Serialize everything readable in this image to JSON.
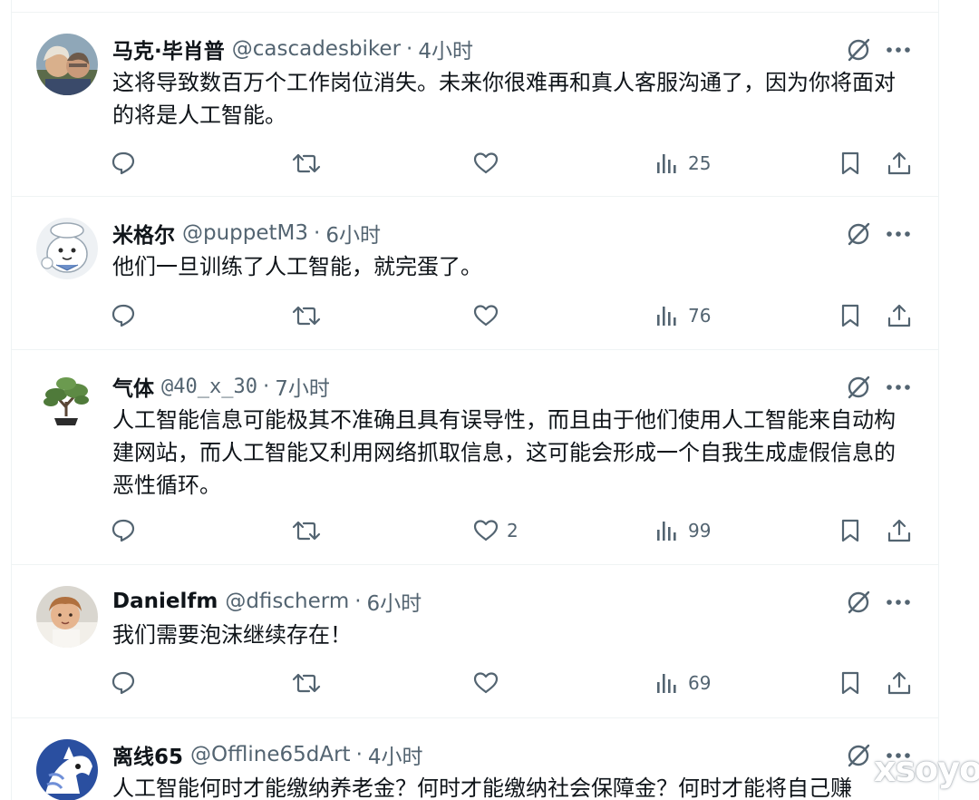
{
  "colors": {
    "text": "#0f1419",
    "secondary": "#536471",
    "border": "#eff3f4"
  },
  "icons": {
    "reply": "reply-icon",
    "retweet": "retweet-icon",
    "like": "heart-icon",
    "views": "views-chart-icon",
    "bookmark": "bookmark-icon",
    "share": "share-icon",
    "grok": "grok-icon",
    "more": "more-dots-icon"
  },
  "tweets": [
    {
      "name": "马克·毕肖普",
      "handle": "@cascadesbiker",
      "sep": "·",
      "time": "4小时",
      "text": "这将导致数百万个工作岗位消失。未来你很难再和真人客服沟通了，因为你将面对的将是人工智能。",
      "likes": "",
      "views": "25"
    },
    {
      "name": "米格尔",
      "handle": "@puppetM3",
      "sep": "·",
      "time": "6小时",
      "text": "他们一旦训练了人工智能，就完蛋了。",
      "likes": "",
      "views": "76"
    },
    {
      "name": "气体",
      "handle": "@40_x_30",
      "sep": "·",
      "time": "7小时",
      "text": "人工智能信息可能极其不准确且具有误导性，而且由于他们使用人工智能来自动构建网站，而人工智能又利用网络抓取信息，这可能会形成一个自我生成虚假信息的恶性循环。",
      "likes": "2",
      "views": "99"
    },
    {
      "name": "Danielfm",
      "handle": "@dfischerm",
      "sep": "·",
      "time": "6小时",
      "text": "我们需要泡沫继续存在！",
      "likes": "",
      "views": "69"
    },
    {
      "name": "离线65",
      "handle": "@Offline65dArt",
      "sep": "·",
      "time": "4小时",
      "text": "人工智能何时才能缴纳养老金？何时才能缴纳社会保障金？何时才能将自己赚",
      "likes": "",
      "views": ""
    }
  ],
  "watermark": "xsoyo"
}
